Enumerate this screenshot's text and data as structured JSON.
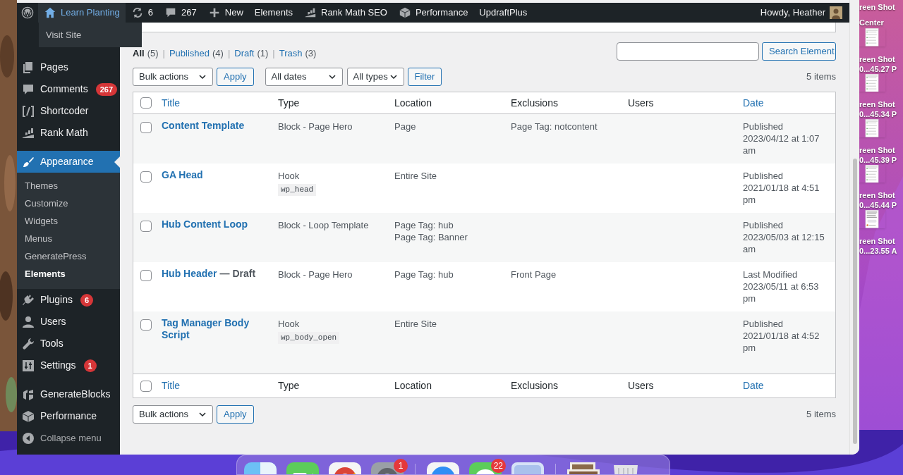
{
  "admin_bar": {
    "items": [
      {
        "kind": "wp-logo",
        "selected": false
      },
      {
        "kind": "site",
        "label": "Learn Planting",
        "selected": true
      },
      {
        "kind": "updates",
        "label": "6",
        "selected": false
      },
      {
        "kind": "comments",
        "label": "267",
        "selected": false
      },
      {
        "kind": "new",
        "label": "New",
        "selected": false
      },
      {
        "kind": "text",
        "label": "Elements",
        "selected": false
      },
      {
        "kind": "rank-math",
        "label": "Rank Math SEO",
        "selected": false
      },
      {
        "kind": "performance",
        "label": "Performance",
        "selected": false
      },
      {
        "kind": "text",
        "label": "UpdraftPlus",
        "selected": false
      }
    ],
    "account": "Howdy, Heather",
    "dropdown": [
      "Visit Site"
    ]
  },
  "sidebar": {
    "items": [
      {
        "kind": "pages",
        "label": "Pages",
        "selected": false
      },
      {
        "kind": "comments",
        "label": "Comments",
        "badge": "267",
        "selected": false
      },
      {
        "kind": "shortcoder",
        "label": "Shortcoder",
        "selected": false
      },
      {
        "kind": "rank-math",
        "label": "Rank Math",
        "selected": false
      },
      {
        "kind": "separator"
      },
      {
        "kind": "appearance",
        "label": "Appearance",
        "selected": true,
        "children": [
          {
            "label": "Themes",
            "selected": false
          },
          {
            "label": "Customize",
            "selected": false
          },
          {
            "label": "Widgets",
            "selected": false
          },
          {
            "label": "Menus",
            "selected": false
          },
          {
            "label": "GeneratePress",
            "selected": false
          },
          {
            "label": "Elements",
            "selected": true
          }
        ]
      },
      {
        "kind": "plugins",
        "label": "Plugins",
        "badge": "6",
        "selected": false
      },
      {
        "kind": "users",
        "label": "Users",
        "selected": false
      },
      {
        "kind": "tools",
        "label": "Tools",
        "selected": false
      },
      {
        "kind": "settings",
        "label": "Settings",
        "badge": "1",
        "selected": false
      },
      {
        "kind": "separator"
      },
      {
        "kind": "generateblocks",
        "label": "GenerateBlocks",
        "selected": false
      },
      {
        "kind": "performance",
        "label": "Performance",
        "selected": false
      },
      {
        "kind": "collapse",
        "label": "Collapse menu",
        "selected": false
      }
    ]
  },
  "status_filters": [
    {
      "label": "All",
      "count": "(5)",
      "selected": true
    },
    {
      "separator": "|",
      "label": "Published",
      "count": "(4)",
      "selected": false
    },
    {
      "separator": "|",
      "label": "Draft",
      "count": "(1)",
      "selected": false
    },
    {
      "separator": "|",
      "label": "Trash",
      "count": "(3)",
      "selected": false
    }
  ],
  "search": {
    "button": "Search Element"
  },
  "top_actions": {
    "bulk_actions": "Bulk actions",
    "apply": "Apply",
    "dates": "All dates",
    "types": "All types",
    "filter": "Filter",
    "items_count": "5 items"
  },
  "table": {
    "select_all_checked": false,
    "columns": [
      {
        "label": "Title",
        "sortable": true
      },
      {
        "label": "Type",
        "sortable": false
      },
      {
        "label": "Location",
        "sortable": false
      },
      {
        "label": "Exclusions",
        "sortable": false
      },
      {
        "label": "Users",
        "sortable": false
      },
      {
        "label": "Date",
        "sortable": true
      }
    ],
    "rows": [
      {
        "title": "Content Template",
        "type": "Block - Page Hero",
        "locations": [
          "Page"
        ],
        "exclusions": [
          "Page Tag: notcontent"
        ],
        "status": "Published",
        "date": "2023/04/12 at 1:07 am",
        "checked": false
      },
      {
        "title": "GA Head",
        "type": "Hook",
        "hook": "wp_head",
        "locations": [
          "Entire Site"
        ],
        "status": "Published",
        "date": "2021/01/18 at 4:51 pm",
        "checked": false
      },
      {
        "title": "Hub Content Loop",
        "type": "Block - Loop Template",
        "locations": [
          "Page Tag: hub",
          "Page Tag: Banner"
        ],
        "status": "Published",
        "date": "2023/05/03 at 12:15 am",
        "checked": false
      },
      {
        "title": "Hub Header",
        "state": "— Draft",
        "type": "Block - Page Hero",
        "locations": [
          "Page Tag: hub"
        ],
        "exclusions": [
          "Front Page"
        ],
        "status": "Last Modified",
        "date": "2023/05/11 at 6:53 pm",
        "checked": false
      },
      {
        "title": "Tag Manager Body Script",
        "type": "Hook",
        "hook": "wp_body_open",
        "locations": [
          "Entire Site"
        ],
        "status": "Published",
        "date": "2021/01/18 at 4:52 pm",
        "checked": false
      }
    ],
    "footer_select_all_checked": false,
    "footer_columns": [
      {
        "label": "Title",
        "sortable": true
      },
      {
        "label": "Type",
        "sortable": false
      },
      {
        "label": "Location",
        "sortable": false
      },
      {
        "label": "Exclusions",
        "sortable": false
      },
      {
        "label": "Users",
        "sortable": false
      },
      {
        "label": "Date",
        "sortable": true
      }
    ]
  },
  "bottom_actions": {
    "bulk_actions": "Bulk actions",
    "apply": "Apply",
    "items_count": "5 items"
  },
  "desktop_files": [
    {
      "kind": "label-only",
      "lines": [
        "reen Shot",
        "Center"
      ]
    },
    {
      "kind": "screenshot",
      "lines": [
        "reen Shot",
        "0...45.27 P"
      ]
    },
    {
      "kind": "screenshot",
      "lines": [
        "reen Shot",
        "0...45.34 P"
      ]
    },
    {
      "kind": "screenshot",
      "lines": [
        "reen Shot",
        "0...45.39 P"
      ]
    },
    {
      "kind": "screenshot",
      "lines": [
        "reen Shot",
        "0...45.44 P"
      ]
    },
    {
      "kind": "chat",
      "lines": [
        "reen Shot",
        "0...23.55 A"
      ]
    }
  ],
  "dock": [
    {
      "kind": "finder"
    },
    {
      "kind": "facetime"
    },
    {
      "kind": "chrome"
    },
    {
      "kind": "settings",
      "badge": "1"
    },
    {
      "kind": "divider"
    },
    {
      "kind": "safari"
    },
    {
      "kind": "messages",
      "badge": "22"
    },
    {
      "kind": "preview"
    },
    {
      "kind": "divider"
    },
    {
      "kind": "photos"
    },
    {
      "kind": "trash"
    }
  ]
}
